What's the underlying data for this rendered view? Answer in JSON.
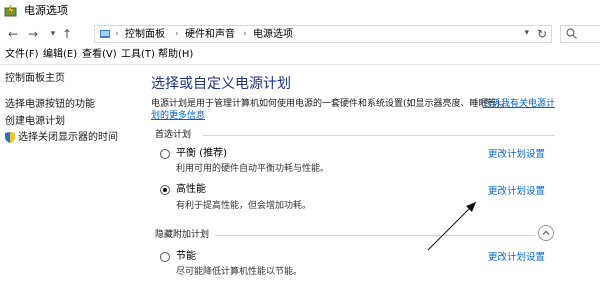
{
  "window": {
    "title": "电源选项"
  },
  "addressbar": {
    "crumbs": [
      "控制面板",
      "硬件和声音",
      "电源选项"
    ]
  },
  "menu": [
    "文件(F)",
    "编辑(E)",
    "查看(V)",
    "工具(T)",
    "帮助(H)"
  ],
  "sidebar": {
    "items": [
      {
        "label": "控制面板主页"
      },
      {
        "label": "选择电源按钮的功能"
      },
      {
        "label": "创建电源计划"
      },
      {
        "label": "选择关闭显示器的时间"
      }
    ]
  },
  "main": {
    "title": "选择或自定义电源计划",
    "description": "电源计划是用于管理计算机如何使用电源的一套硬件和系统设置(如显示器亮度、睡眠等)。",
    "description_link_1": "告诉我有关电源计",
    "description_link_2": "划的更多信息",
    "preferred_label": "首选计划",
    "hidden_label": "隐藏附加计划",
    "plans": [
      {
        "name": "平衡 (推荐)",
        "desc": "利用可用的硬件自动平衡功耗与性能。",
        "link": "更改计划设置",
        "checked": false
      },
      {
        "name": "高性能",
        "desc": "有利于提高性能，但会增加功耗。",
        "link": "更改计划设置",
        "checked": true
      },
      {
        "name": "节能",
        "desc": "尽可能降低计算机性能以节能。",
        "link": "更改计划设置",
        "checked": false
      }
    ]
  },
  "icons": [
    "power-options-icon",
    "back-icon",
    "forward-icon",
    "up-icon",
    "control-panel-icon",
    "refresh-icon",
    "search-icon",
    "shield-icon",
    "collapse-icon"
  ]
}
